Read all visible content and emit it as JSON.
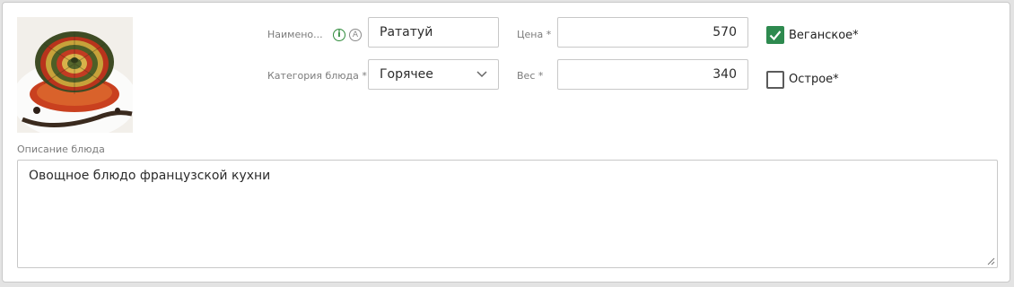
{
  "form": {
    "name": {
      "label": "Наимено...",
      "value": "Рататуй",
      "info_icon": "info-icon",
      "auto_icon": "auto-translate-icon",
      "info_glyph": "i",
      "auto_glyph": "A"
    },
    "category": {
      "label": "Категория блюда *",
      "value": "Горячее",
      "icon": "chevron-down-icon"
    },
    "price": {
      "label": "Цена *",
      "value": "570"
    },
    "weight": {
      "label": "Вес *",
      "value": "340"
    },
    "vegan": {
      "label": "Веганское*",
      "checked": true
    },
    "spicy": {
      "label": "Острое*",
      "checked": false
    },
    "description": {
      "label": "Описание блюда",
      "value": "Овощное блюдо французской кухни"
    }
  },
  "colors": {
    "accent": "#2e8a4f",
    "info": "#2e8a3a"
  }
}
